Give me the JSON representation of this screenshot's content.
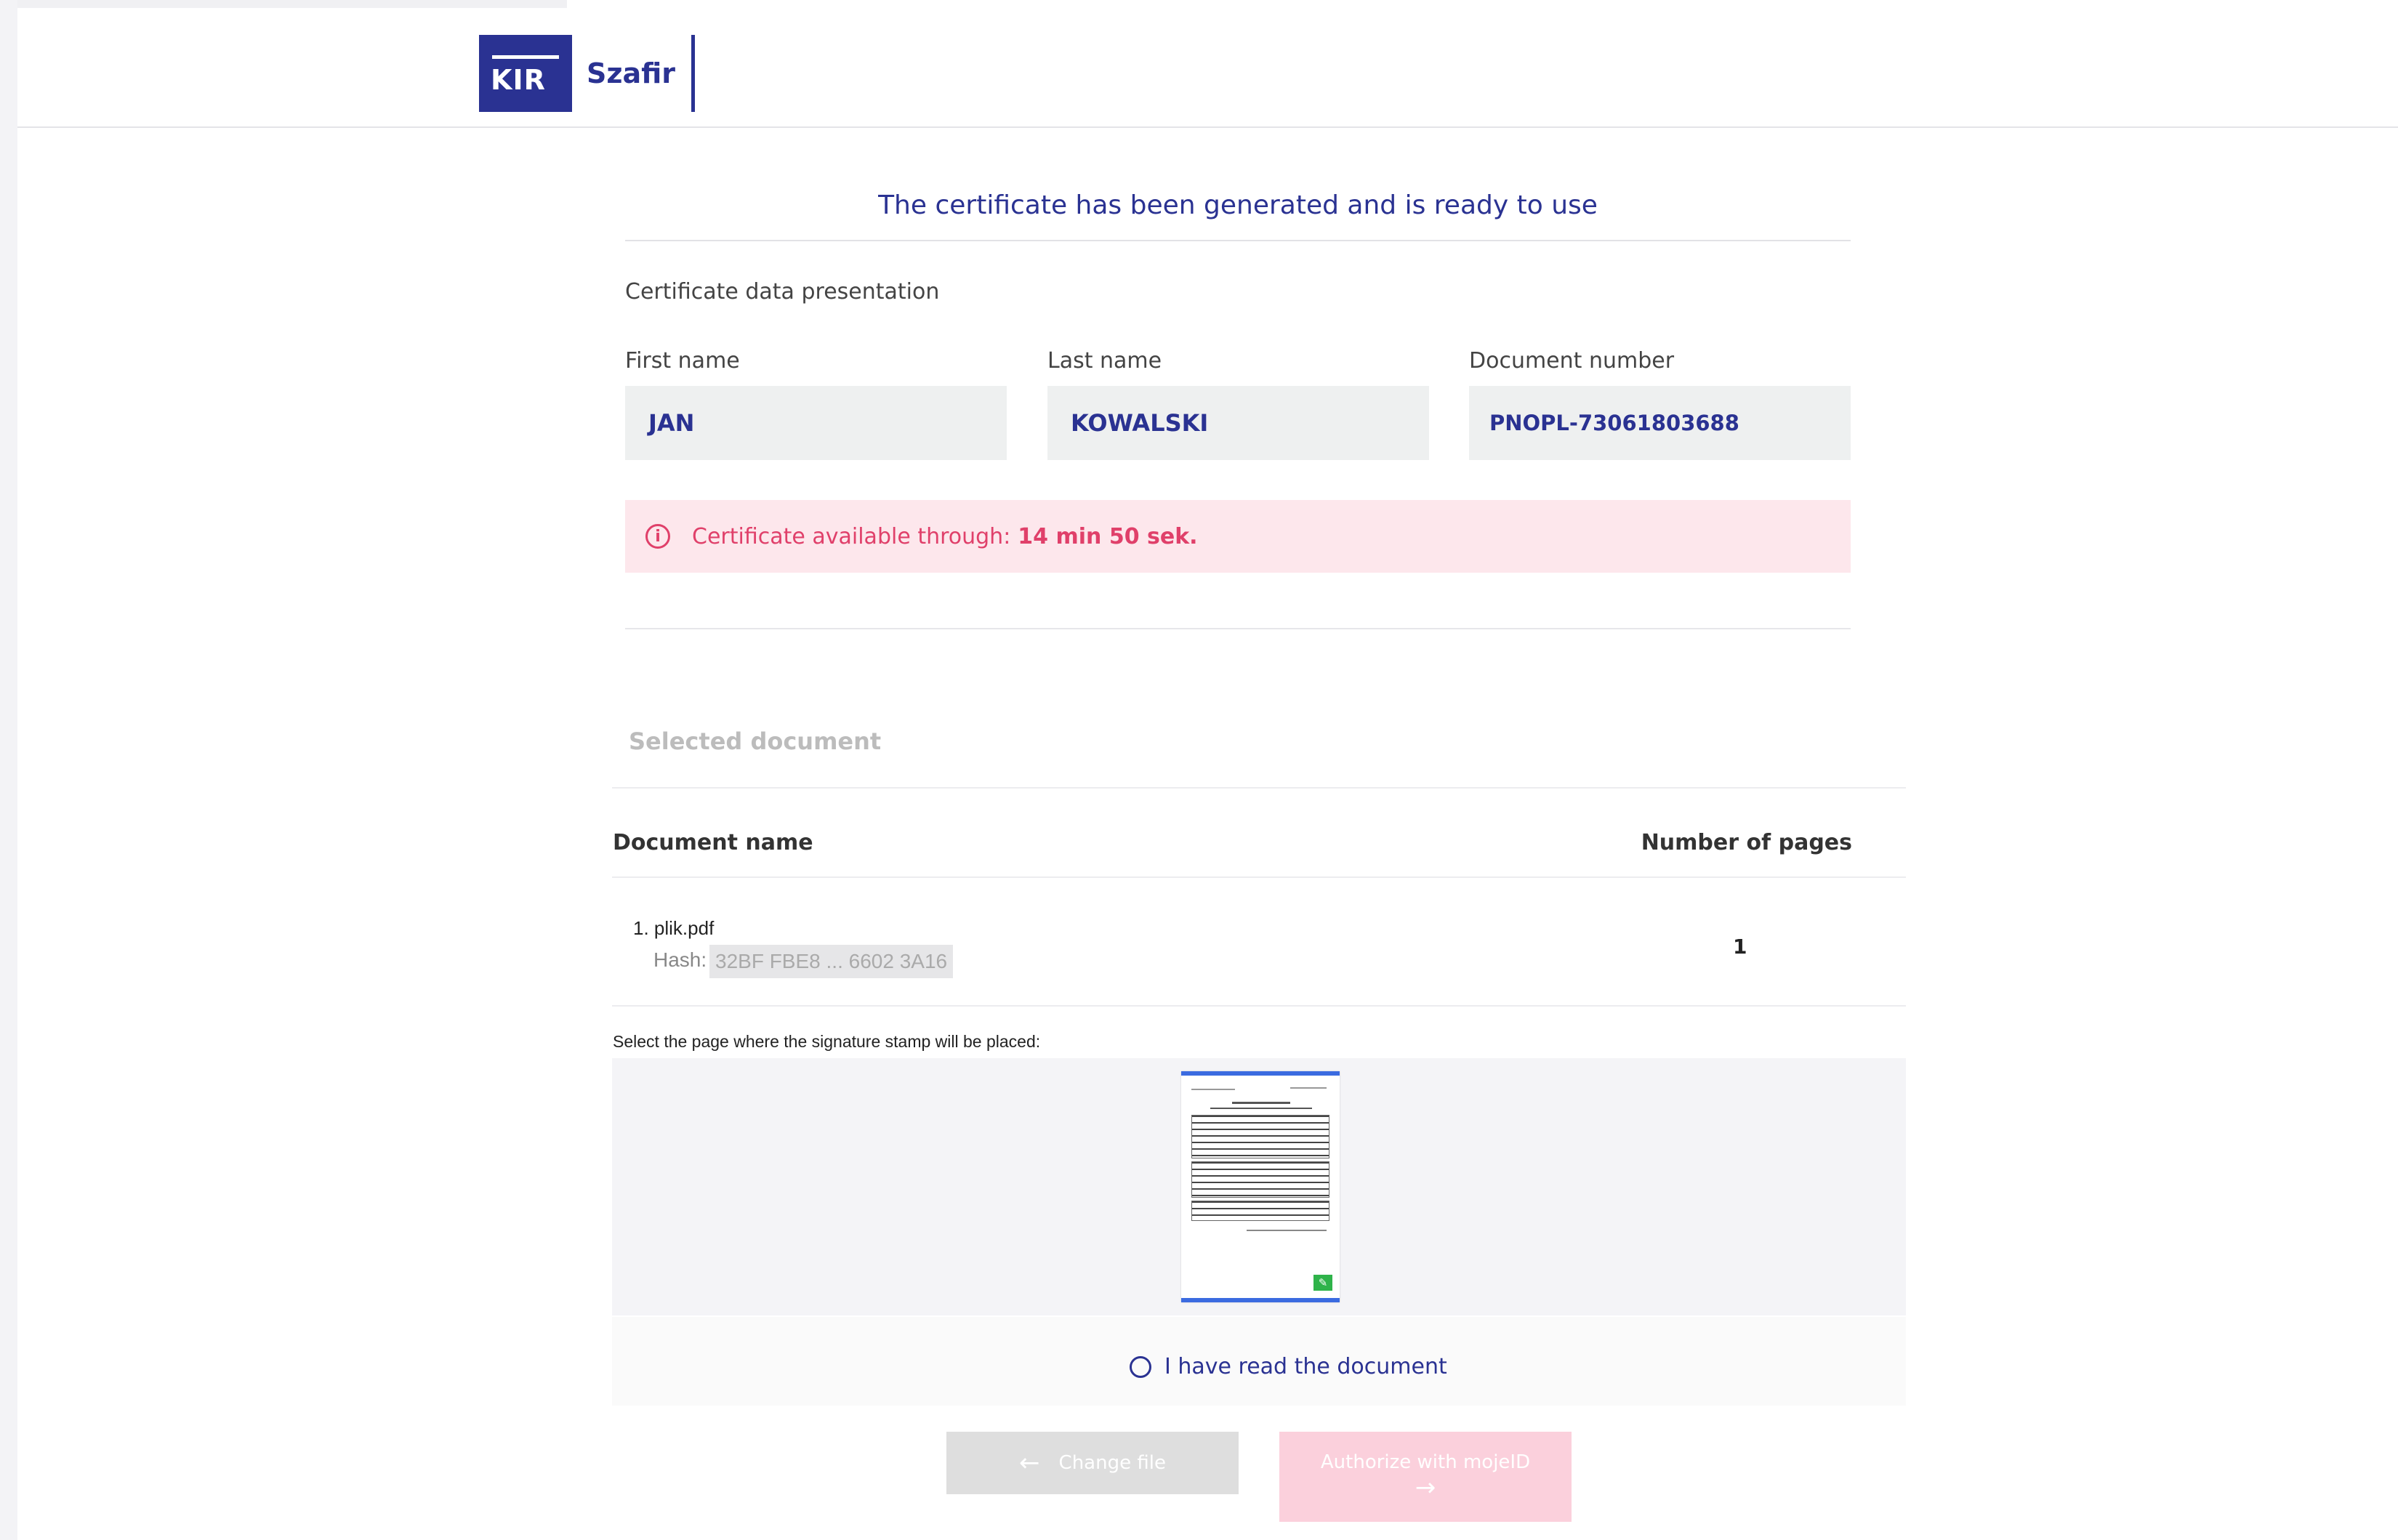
{
  "header": {
    "logo_mark": "KIR",
    "logo_text": "Szafir"
  },
  "main": {
    "title": "The certificate has been generated and is ready to use",
    "subtitle": "Certificate data presentation",
    "fields": {
      "first_name": {
        "label": "First name",
        "value": "JAN"
      },
      "last_name": {
        "label": "Last name",
        "value": "KOWALSKI"
      },
      "document_number": {
        "label": "Document number",
        "value": "PNOPL-73061803688"
      }
    },
    "notice": {
      "icon": "info-icon",
      "text": "Certificate available through:",
      "value": "14 min 50 sek.",
      "color": "#e0406a"
    }
  },
  "documents": {
    "section_title": "Selected document",
    "columns": [
      "Document name",
      "Number of pages"
    ],
    "rows": [
      {
        "name": "1. plik.pdf",
        "hash_label": "Hash:",
        "hash": "32BF FBE8 ... 6602 3A16",
        "pages": "1"
      }
    ],
    "select_page_label": "Select the page where the signature stamp will be placed:",
    "read_checkbox_label": "I have read the document"
  },
  "buttons": {
    "change_file": "Change file",
    "authorize": "Authorize with mojeID"
  },
  "colors": {
    "brand": "#2a3292",
    "alert": "#e0406a",
    "thumb_highlight": "#3b6be0"
  }
}
